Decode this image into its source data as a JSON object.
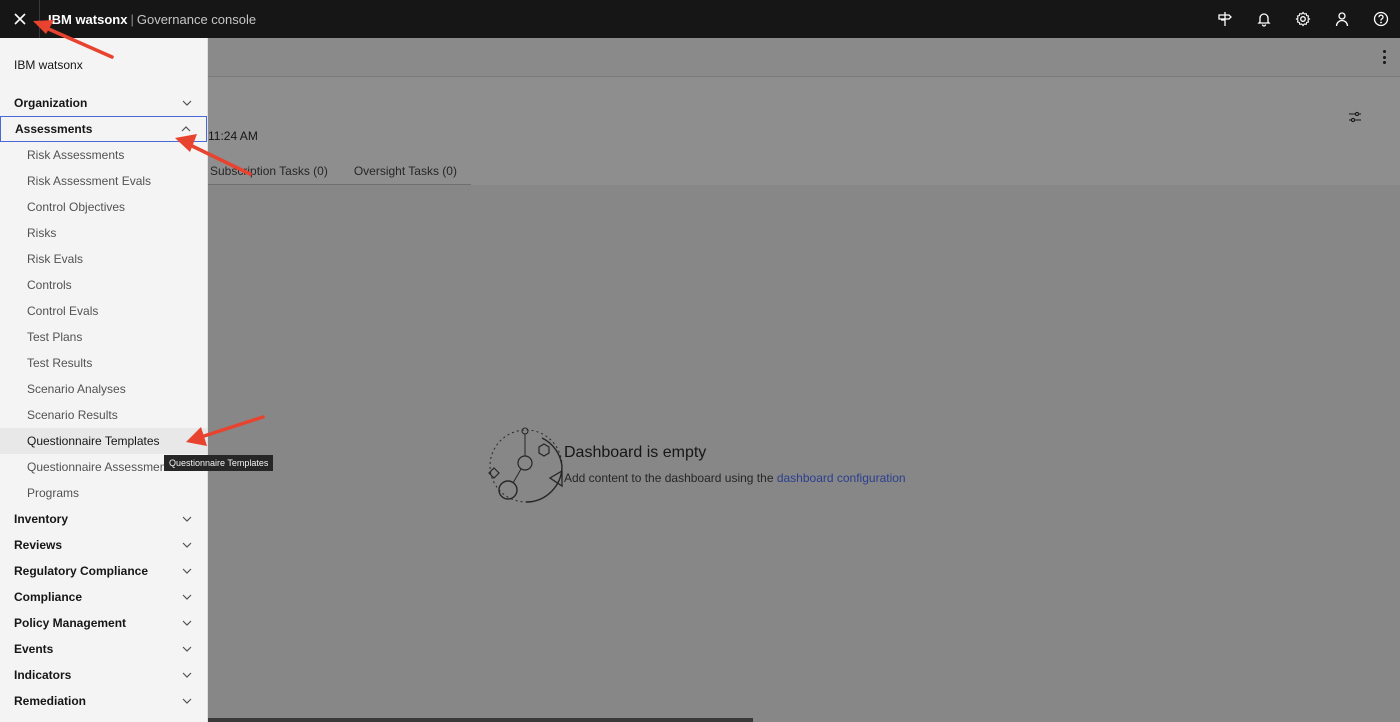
{
  "header": {
    "brand_name": "IBM watsonx",
    "separator": "|",
    "product_name": "Governance console",
    "icons": [
      "close-icon",
      "signpost-icon",
      "notification-icon",
      "settings-icon",
      "user-icon",
      "help-icon"
    ]
  },
  "dashboard": {
    "timestamp": "11:24 AM",
    "tabs": [
      {
        "label": "Subscription Tasks (0)"
      },
      {
        "label": "Oversight Tasks (0)"
      }
    ],
    "empty_title": "Dashboard is empty",
    "empty_desc_prefix": "Add content to the dashboard using the ",
    "empty_desc_link": "dashboard configuration"
  },
  "sidenav": {
    "title": "IBM watsonx",
    "sections": [
      {
        "label": "Organization",
        "expanded": false
      },
      {
        "label": "Assessments",
        "expanded": true
      }
    ],
    "assessment_items": [
      {
        "label": "Risk Assessments"
      },
      {
        "label": "Risk Assessment Evals"
      },
      {
        "label": "Control Objectives"
      },
      {
        "label": "Risks"
      },
      {
        "label": "Risk Evals"
      },
      {
        "label": "Controls"
      },
      {
        "label": "Control Evals"
      },
      {
        "label": "Test Plans"
      },
      {
        "label": "Test Results"
      },
      {
        "label": "Scenario Analyses"
      },
      {
        "label": "Scenario Results"
      },
      {
        "label": "Questionnaire Templates"
      },
      {
        "label": "Questionnaire Assessments"
      },
      {
        "label": "Programs"
      }
    ],
    "more_sections": [
      {
        "label": "Inventory"
      },
      {
        "label": "Reviews"
      },
      {
        "label": "Regulatory Compliance"
      },
      {
        "label": "Compliance"
      },
      {
        "label": "Policy Management"
      },
      {
        "label": "Events"
      },
      {
        "label": "Indicators"
      },
      {
        "label": "Remediation"
      }
    ]
  },
  "tooltip": {
    "text": "Questionnaire Templates"
  },
  "colors": {
    "header_bg": "#161616",
    "nav_bg": "#f4f4f4",
    "overlay_bg": "#8e8e8e",
    "focus_border": "#4a69d6",
    "link": "#2a3f8f",
    "annotation_arrow": "#e8432f"
  }
}
